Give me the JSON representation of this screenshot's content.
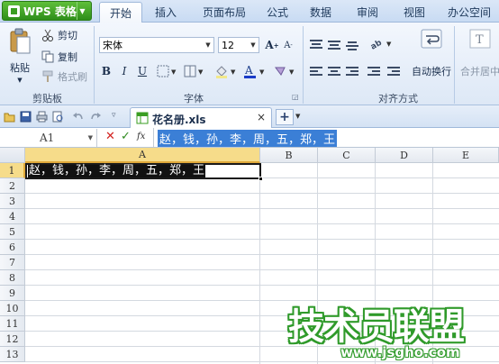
{
  "app": {
    "name": "WPS 表格"
  },
  "menu": {
    "tabs": [
      "开始",
      "插入",
      "页面布局",
      "公式",
      "数据",
      "审阅",
      "视图",
      "办公空间"
    ],
    "active": "开始"
  },
  "ribbon": {
    "clipboard": {
      "paste": "粘贴",
      "cut": "剪切",
      "copy": "复制",
      "format_painter": "格式刷",
      "label": "剪贴板"
    },
    "font": {
      "name": "宋体",
      "size": "12",
      "label": "字体",
      "bold": "B",
      "italic": "I",
      "underline": "U",
      "grow": "A",
      "shrink": "A"
    },
    "alignment": {
      "wrap": "自动换行",
      "merge": "合并居中",
      "label": "对齐方式"
    }
  },
  "document": {
    "filename": "花名册.xls",
    "close": "×",
    "add": "+"
  },
  "formula_bar": {
    "cell_ref": "A1",
    "fx": "fx",
    "content": "赵，钱，孙，李，周，五，郑，王"
  },
  "sheet": {
    "columns": [
      "A",
      "B",
      "C",
      "D",
      "E"
    ],
    "rows": [
      "1",
      "2",
      "3",
      "4",
      "5",
      "6",
      "7",
      "8",
      "9",
      "10",
      "11",
      "12",
      "13"
    ],
    "cells": {
      "A1": "赵，钱，孙，李，周，五，郑，王"
    }
  },
  "watermark": {
    "title": "技术员联盟",
    "url": "www.jsgho.com"
  },
  "colors": {
    "selection": "#3b7fd6",
    "active_header": "#f6dc8a",
    "brand_green": "#3a9e22"
  }
}
